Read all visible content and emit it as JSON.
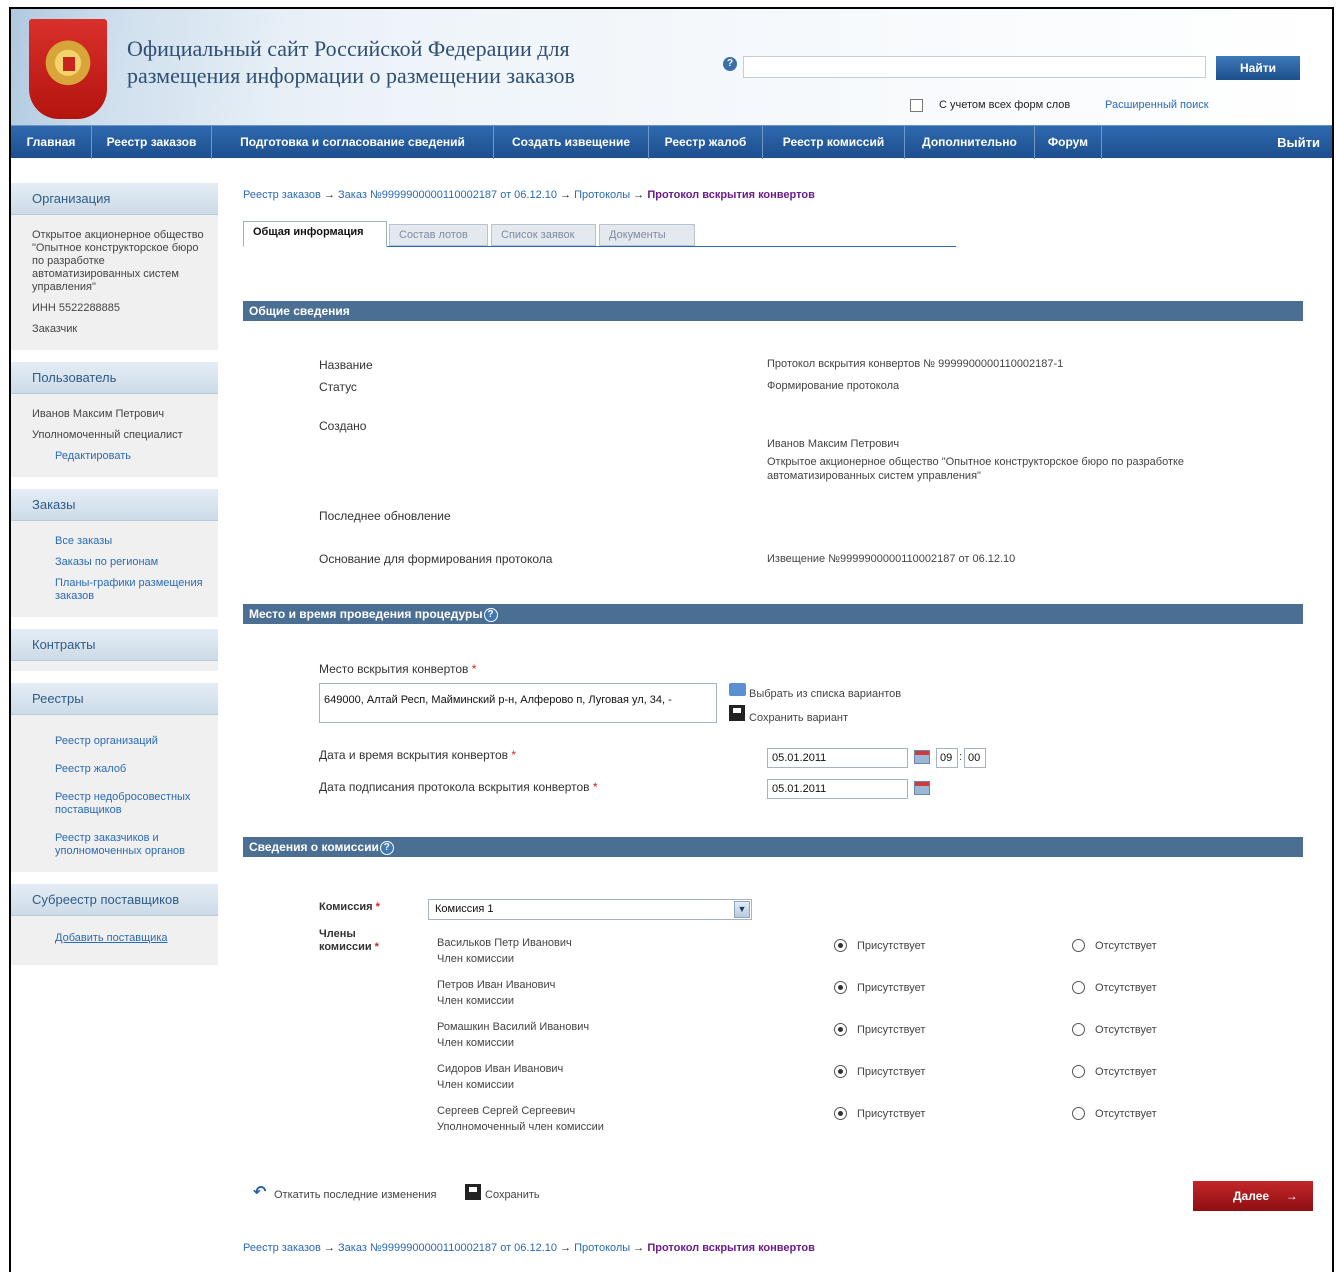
{
  "header": {
    "title_line1": "Официальный сайт Российской Федерации для",
    "title_line2": "размещения информации о размещении заказов",
    "search_button": "Найти",
    "help_glyph": "?",
    "wordforms_label": "С учетом всех форм слов",
    "advanced_search": "Расширенный поиск"
  },
  "nav": {
    "items": [
      "Главная",
      "Реестр заказов",
      "Подготовка и согласование сведений",
      "Создать извещение",
      "Реестр жалоб",
      "Реестр комиссий",
      "Дополнительно",
      "Форум"
    ],
    "exit": "Выйти"
  },
  "sidebar": {
    "org": {
      "title": "Организация",
      "name": "Открытое акционерное общество \"Опытное конструкторское бюро по разработке автоматизированных систем управления\"",
      "inn": "ИНН 5522288885",
      "role": "Заказчик"
    },
    "user": {
      "title": "Пользователь",
      "name": "Иванов Максим Петрович",
      "role": "Уполномоченный специалист",
      "edit": "Редактировать"
    },
    "orders": {
      "title": "Заказы",
      "items": [
        "Все заказы",
        "Заказы по регионам",
        "Планы-графики размещения заказов"
      ]
    },
    "contracts": {
      "title": "Контракты"
    },
    "registries": {
      "title": "Реестры",
      "items": [
        "Реестр организаций",
        "Реестр жалоб",
        "Реестр недобросовестных поставщиков",
        "Реестр заказчиков и уполномоченных органов"
      ]
    },
    "suppliers": {
      "title": "Субреестр поставщиков",
      "add": "Добавить поставщика"
    }
  },
  "breadcrumb": {
    "items": [
      "Реестр заказов",
      "Заказ №999990000011000218​7 от 06.12.10",
      "Протоколы"
    ],
    "current": "Протокол вскрытия конвертов",
    "arrow": "→"
  },
  "tabs": [
    "Общая информация",
    "Состав лотов",
    "Список заявок",
    "Документы"
  ],
  "general": {
    "title": "Общие сведения",
    "name_label": "Название",
    "name_value": "Протокол вскрытия конвертов № 999990000011000218​7-1",
    "status_label": "Статус",
    "status_value": "Формирование протокола",
    "created_label": "Создано",
    "created_person": "Иванов Максим Петрович",
    "created_org": "Открытое акционерное общество \"Опытное конструкторское бюро по разработке автоматизированных систем управления\"",
    "updated_label": "Последнее обновление",
    "basis_label": "Основание для формирования протокола",
    "basis_value": "Извещение №999990000011000218​7 от 06.12.10"
  },
  "place": {
    "title": "Место и время проведения процедуры",
    "place_label": "Место вскрытия конвертов",
    "place_value": "649000, Алтай Респ, Майминский р-н, Алферово п, Луговая ул, 34, -",
    "choose_variant": "Выбрать из списка вариантов",
    "save_variant": "Сохранить вариант",
    "open_date_label": "Дата и время вскрытия конвертов",
    "open_date": "05.01.2011",
    "open_hour": "09",
    "open_min": "00",
    "sign_date_label": "Дата подписания протокола вскрытия конвертов",
    "sign_date": "05.01.2011"
  },
  "commission": {
    "title": "Сведения о комиссии",
    "commission_label": "Комиссия",
    "commission_value": "Комиссия 1",
    "members_label": "Члены комиссии",
    "present": "Присутствует",
    "absent": "Отсутствует",
    "members": [
      {
        "name": "Васильков Петр Иванович",
        "role": "Член комиссии"
      },
      {
        "name": "Петров Иван Иванович",
        "role": "Член комиссии"
      },
      {
        "name": "Ромашкин Василий Иванович",
        "role": "Член комиссии"
      },
      {
        "name": "Сидоров Иван Иванович",
        "role": "Член комиссии"
      },
      {
        "name": "Сергеев Сергей Сергеевич",
        "role": "Уполномоченный член комиссии"
      }
    ]
  },
  "actions": {
    "revert": "Откатить последние изменения",
    "save": "Сохранить",
    "next": "Далее",
    "next_arrow": "→"
  },
  "required_mark": "*"
}
